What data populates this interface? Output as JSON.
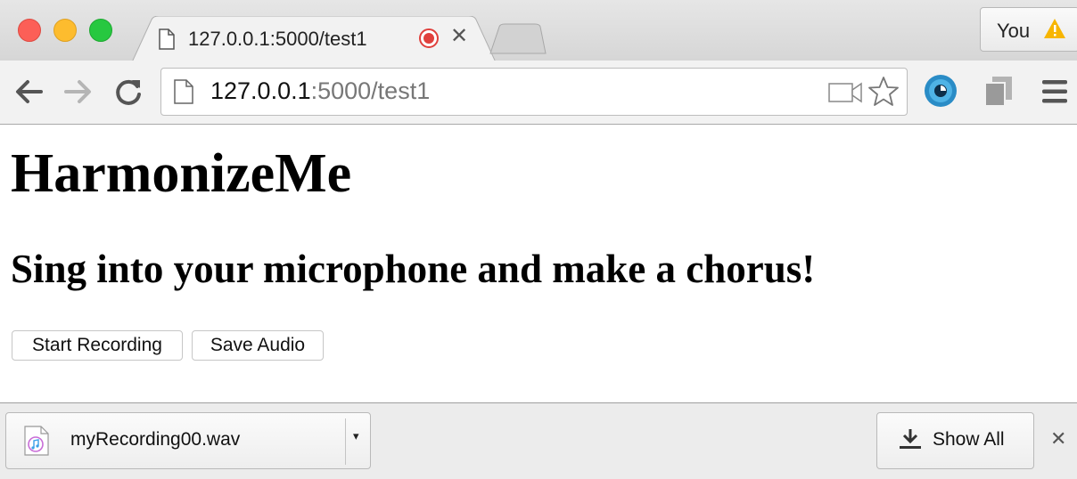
{
  "browser": {
    "tab": {
      "title": "127.0.0.1:5000/test1",
      "close_glyph": "✕",
      "recording_indicator": "record-icon"
    },
    "profile": {
      "name": "You",
      "warning_icon": "warning-icon"
    },
    "address": {
      "host": "127.0.0.1",
      "rest": ":5000/test1"
    },
    "icons": [
      "back-icon",
      "forward-icon",
      "reload-icon",
      "page-icon",
      "camera-icon",
      "star-icon",
      "extension-eye-icon",
      "extension-copy-icon",
      "menu-icon"
    ],
    "colors": {
      "record_red": "#e0403c",
      "warning_yellow": "#f7b500"
    }
  },
  "page": {
    "heading": "HarmonizeMe",
    "subheading": "Sing into your microphone and make a chorus!",
    "buttons": {
      "start_recording": "Start Recording",
      "save_audio": "Save Audio"
    }
  },
  "downloads": {
    "item": {
      "filename": "myRecording00.wav",
      "file_icon": "audio-file-icon",
      "menu_glyph": "▾"
    },
    "show_all": "Show All",
    "close_glyph": "✕"
  }
}
